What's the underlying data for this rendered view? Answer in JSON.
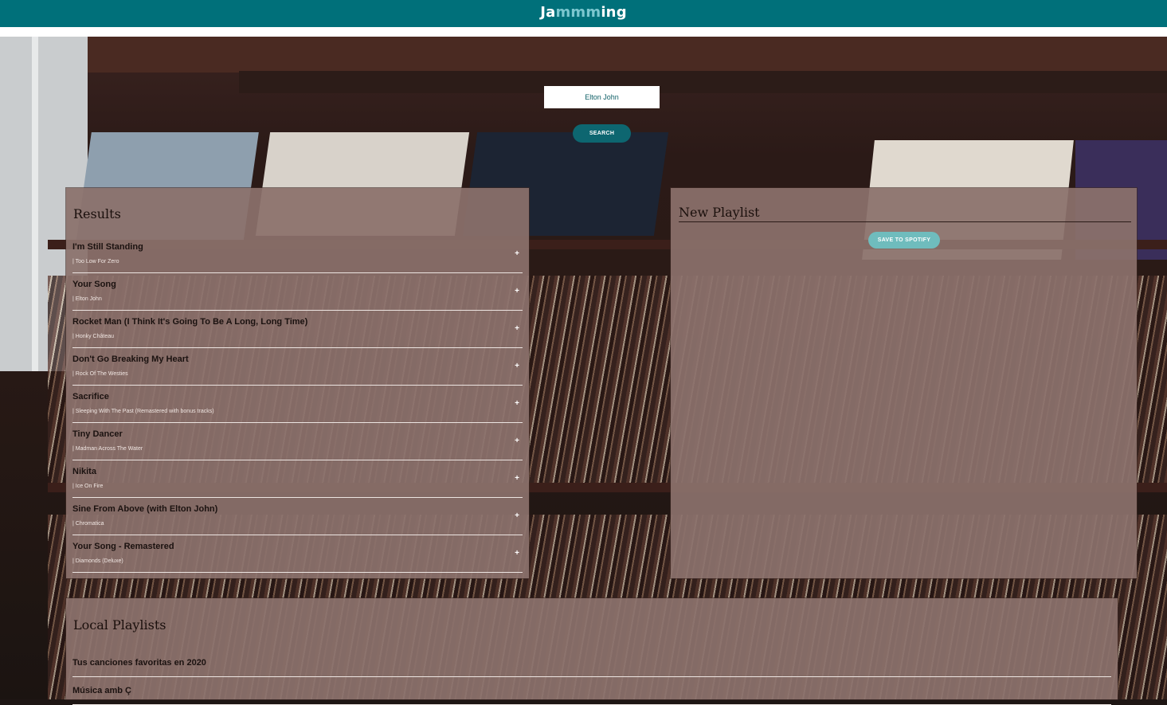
{
  "header": {
    "brand_prefix": "Ja",
    "brand_accent": "mmm",
    "brand_suffix": "ing",
    "bar_color": "#00707a",
    "accent_color": "#7cc7cf"
  },
  "search": {
    "value": "Elton John",
    "button_label": "SEARCH"
  },
  "results": {
    "title": "Results",
    "add_symbol": "+",
    "tracks": [
      {
        "name": "I'm Still Standing",
        "album": "| Too Low For Zero"
      },
      {
        "name": "Your Song",
        "album": "| Elton John"
      },
      {
        "name": "Rocket Man (I Think It's Going To Be A Long, Long Time)",
        "album": "| Honky Château"
      },
      {
        "name": "Don't Go Breaking My Heart",
        "album": "| Rock Of The Westies"
      },
      {
        "name": "Sacrifice",
        "album": "| Sleeping With The Past (Remastered with bonus tracks)"
      },
      {
        "name": "Tiny Dancer",
        "album": "| Madman Across The Water"
      },
      {
        "name": "Nikita",
        "album": "| Ice On Fire"
      },
      {
        "name": "Sine From Above (with Elton John)",
        "album": "| Chromatica"
      },
      {
        "name": "Your Song - Remastered",
        "album": "| Diamonds (Deluxe)"
      }
    ]
  },
  "playlist": {
    "title": "New Playlist",
    "save_label": "SAVE TO SPOTIFY"
  },
  "local": {
    "title": "Local Playlists",
    "items": [
      {
        "name": "Tus canciones favoritas en 2020"
      },
      {
        "name": "Música amb Ç"
      }
    ]
  }
}
